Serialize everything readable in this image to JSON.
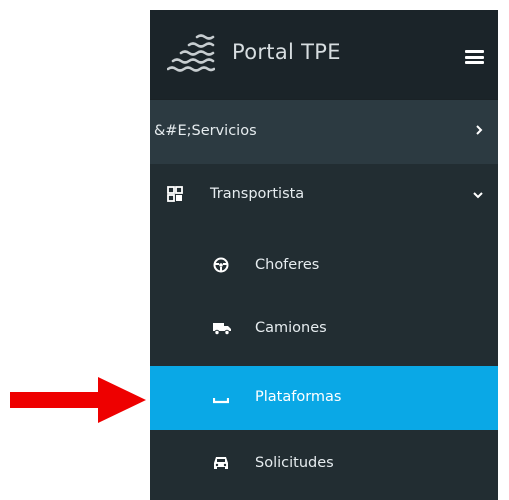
{
  "brand": {
    "title": "Portal TPE",
    "logo_icon": "waves-logo-icon",
    "menu_icon": "hamburger-menu-icon"
  },
  "menu": {
    "servicios": {
      "label": "&#E;Servicios",
      "chevron": "chevron-right-icon"
    },
    "transportista": {
      "label": "Transportista",
      "icon": "grid-icon",
      "chevron": "chevron-down-icon"
    },
    "sub_items": [
      {
        "label": "Choferes",
        "icon": "steering-wheel-icon"
      },
      {
        "label": "Camiones",
        "icon": "truck-icon"
      },
      {
        "label": "Plataformas",
        "icon": "platform-icon",
        "active": true
      },
      {
        "label": "Solicitudes",
        "icon": "car-icon"
      }
    ]
  },
  "colors": {
    "sidebar_bg": "#222d32",
    "header_bg": "#1b2429",
    "hover_bg": "#2c3a41",
    "active_bg": "#0aa8e6",
    "annotation_arrow": "#ee0000"
  }
}
